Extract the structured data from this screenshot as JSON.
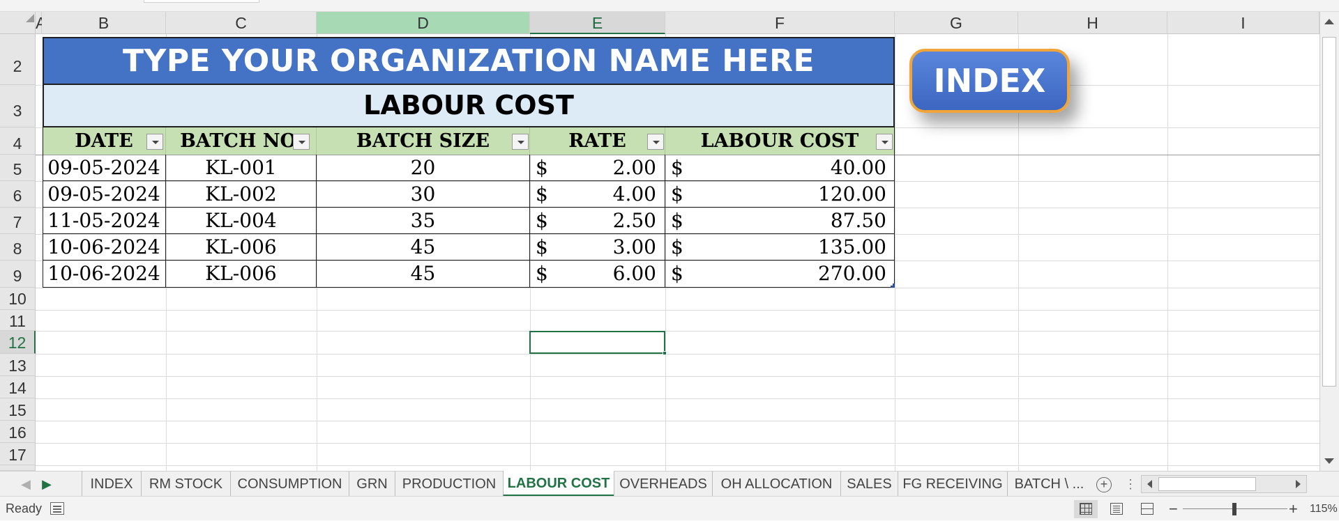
{
  "columns": [
    "A",
    "B",
    "C",
    "D",
    "E",
    "F",
    "G",
    "H",
    "I"
  ],
  "rows": [
    "2",
    "3",
    "4",
    "5",
    "6",
    "7",
    "8",
    "9",
    "10",
    "11",
    "12",
    "13",
    "14",
    "15",
    "16",
    "17"
  ],
  "sheet": {
    "org_name": "TYPE YOUR ORGANIZATION NAME HERE",
    "report_title": "LABOUR COST",
    "headers": [
      "DATE",
      "BATCH NO.",
      "BATCH SIZE",
      "RATE",
      "LABOUR COST"
    ],
    "currency_symbol": "$",
    "data_rows": [
      {
        "date": "09-05-2024",
        "batch_no": "KL-001",
        "batch_size": "20",
        "rate": "2.00",
        "labour_cost": "40.00"
      },
      {
        "date": "09-05-2024",
        "batch_no": "KL-002",
        "batch_size": "30",
        "rate": "4.00",
        "labour_cost": "120.00"
      },
      {
        "date": "11-05-2024",
        "batch_no": "KL-004",
        "batch_size": "35",
        "rate": "2.50",
        "labour_cost": "87.50"
      },
      {
        "date": "10-06-2024",
        "batch_no": "KL-006",
        "batch_size": "45",
        "rate": "3.00",
        "labour_cost": "135.00"
      },
      {
        "date": "10-06-2024",
        "batch_no": "KL-006",
        "batch_size": "45",
        "rate": "6.00",
        "labour_cost": "270.00"
      }
    ]
  },
  "index_button": {
    "label": "INDEX"
  },
  "tabs": [
    "INDEX",
    "RM STOCK",
    "CONSUMPTION",
    "GRN",
    "PRODUCTION",
    "LABOUR COST",
    "OVERHEADS",
    "OH ALLOCATION",
    "SALES",
    "FG RECEIVING",
    "BATCH \\ ..."
  ],
  "active_tab": "LABOUR COST",
  "status": {
    "ready_text": "Ready",
    "zoom": "115%"
  },
  "colors": {
    "title_bg": "#4472c4",
    "subtitle_bg": "#ddebf7",
    "header_bg": "#c6e0b4",
    "accent": "#217346",
    "button_border": "#f0a43a"
  }
}
